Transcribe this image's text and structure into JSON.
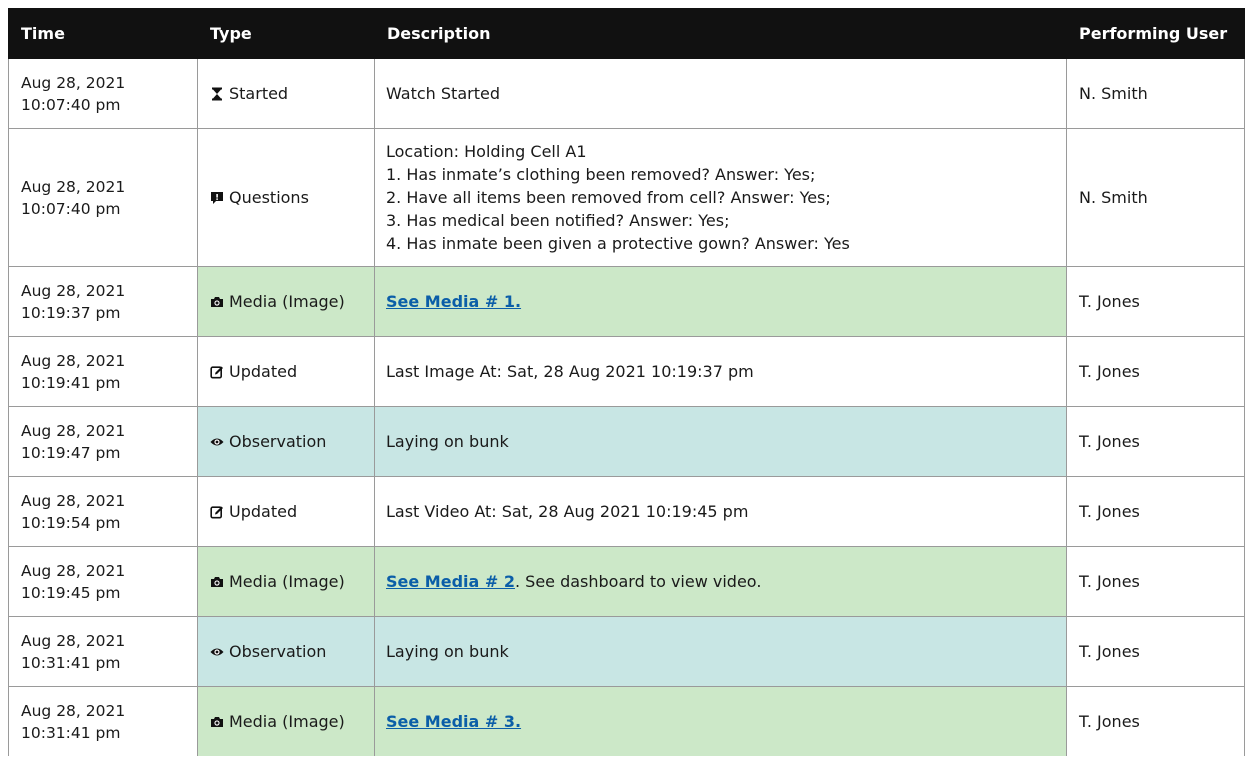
{
  "headers": {
    "time": "Time",
    "type": "Type",
    "description": "Description",
    "user": "Performing User"
  },
  "rows": [
    {
      "date": "Aug 28, 2021",
      "clock": "10:07:40 pm",
      "icon": "hourglass-icon",
      "type": "Started",
      "desc": "Watch Started",
      "user": "N. Smith"
    },
    {
      "date": "Aug 28, 2021",
      "clock": "10:07:40 pm",
      "icon": "comment-exclamation-icon",
      "type": "Questions",
      "lines": [
        "Location: Holding Cell A1",
        "1. Has inmate’s clothing been removed? Answer: Yes;",
        "2. Have all items been removed from cell? Answer: Yes;",
        "3. Has medical been notified? Answer: Yes;",
        "4. Has inmate been given a protective gown? Answer: Yes"
      ],
      "user": "N. Smith"
    },
    {
      "date": "Aug 28, 2021",
      "clock": "10:19:37 pm",
      "icon": "camera-icon",
      "type": "Media (Image)",
      "link": "See Media # 1.",
      "user": "T. Jones"
    },
    {
      "date": "Aug 28, 2021",
      "clock": "10:19:41 pm",
      "icon": "edit-icon",
      "type": "Updated",
      "desc": "Last Image At: Sat, 28 Aug 2021 10:19:37 pm",
      "user": "T. Jones"
    },
    {
      "date": "Aug 28, 2021",
      "clock": "10:19:47 pm",
      "icon": "eye-icon",
      "type": "Observation",
      "desc": "Laying on bunk",
      "user": "T. Jones"
    },
    {
      "date": "Aug 28, 2021",
      "clock": "10:19:54 pm",
      "icon": "edit-icon",
      "type": "Updated",
      "desc": "Last Video At: Sat, 28 Aug 2021 10:19:45 pm",
      "user": "T. Jones"
    },
    {
      "date": "Aug 28, 2021",
      "clock": "10:19:45 pm",
      "icon": "camera-icon",
      "type": "Media (Image)",
      "link": "See Media # 2",
      "desc": ". See dashboard to view video.",
      "user": "T. Jones"
    },
    {
      "date": "Aug 28, 2021",
      "clock": "10:31:41 pm",
      "icon": "eye-icon",
      "type": "Observation",
      "desc": "Laying on bunk",
      "user": "T. Jones"
    },
    {
      "date": "Aug 28, 2021",
      "clock": "10:31:41 pm",
      "icon": "camera-icon",
      "type": "Media (Image)",
      "link": "See Media # 3.",
      "user": "T. Jones"
    }
  ],
  "colors": {
    "header_bg": "#111111",
    "image_row_bg": "#cce8c8",
    "observation_row_bg": "#c8e6e4",
    "link": "#0b5ea8"
  }
}
